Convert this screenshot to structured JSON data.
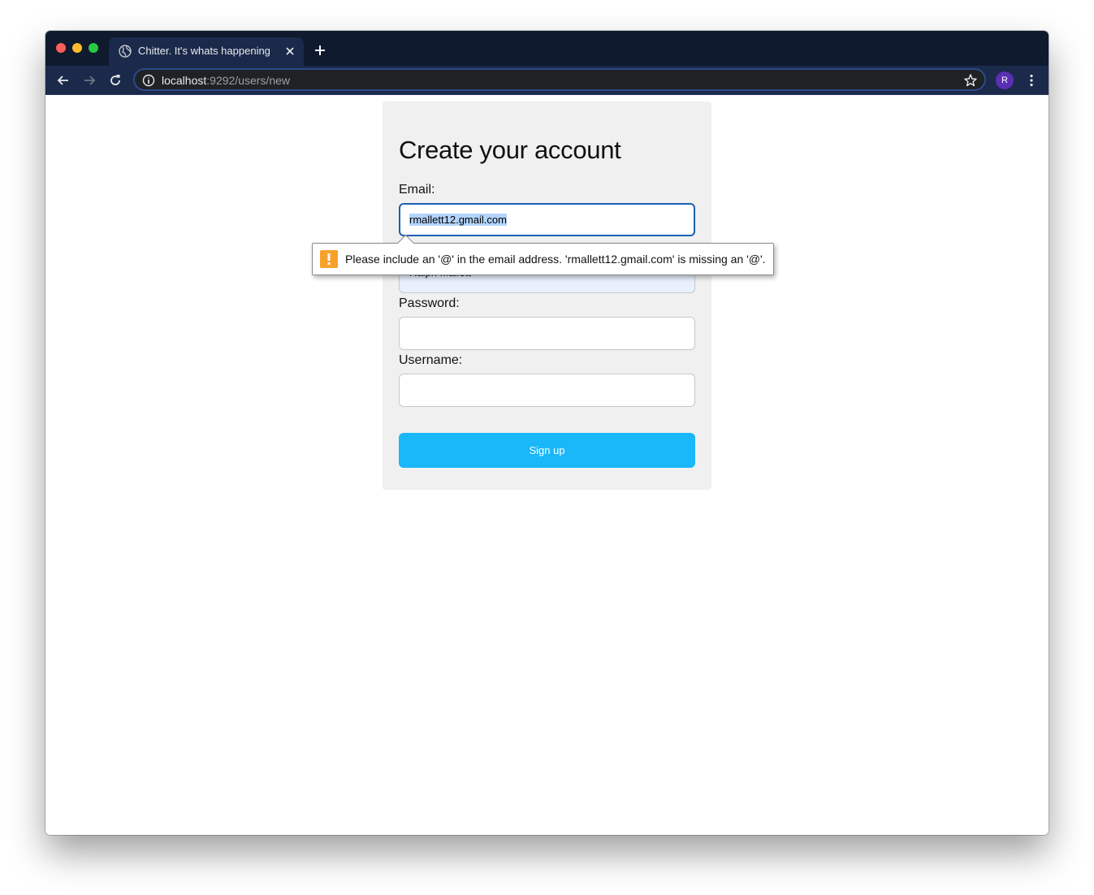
{
  "browser": {
    "tab_title": "Chitter. It's whats happening",
    "url_host": "localhost",
    "url_path": ":9292/users/new",
    "profile_initial": "R",
    "colors": {
      "tabstrip": "#0f1a2f",
      "toolbar": "#1b2a4a",
      "avatar": "#5b2fb5"
    }
  },
  "form": {
    "heading": "Create your account",
    "email_label": "Email:",
    "email_value": "rmallett12.gmail.com",
    "name_value": "Ralph Mallett",
    "password_label": "Password:",
    "username_label": "Username:",
    "signup_label": "Sign up",
    "colors": {
      "button": "#1ab7f9",
      "focus_border": "#1a5fb4",
      "card": "#f0f0f0"
    }
  },
  "validation": {
    "message": "Please include an '@' in the email address. 'rmallett12.gmail.com' is missing an '@'.",
    "icon": "warning-icon",
    "color": "#f7a12a"
  }
}
